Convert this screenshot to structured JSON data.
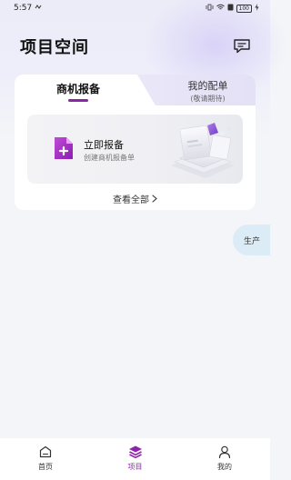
{
  "status_bar": {
    "time": "5:57",
    "battery": "100"
  },
  "header": {
    "title": "项目空间",
    "message_icon": "message-icon"
  },
  "card": {
    "tabs": [
      {
        "label": "商机报备",
        "active": true
      },
      {
        "label": "我的配单",
        "sub_label": "(敬请期待)",
        "active": false
      }
    ],
    "banner": {
      "title": "立即报备",
      "subtitle": "创建商机报备单",
      "icon": "document-plus-icon"
    },
    "view_all": "查看全部"
  },
  "float_button": {
    "label": "生产"
  },
  "bottom_nav": {
    "items": [
      {
        "label": "首页",
        "icon": "home-icon",
        "active": false
      },
      {
        "label": "项目",
        "icon": "layers-icon",
        "active": true
      },
      {
        "label": "我的",
        "icon": "user-icon",
        "active": false
      }
    ]
  },
  "colors": {
    "accent": "#8e24aa",
    "background": "#f4f5f8",
    "float_bg": "#dcecf6"
  }
}
